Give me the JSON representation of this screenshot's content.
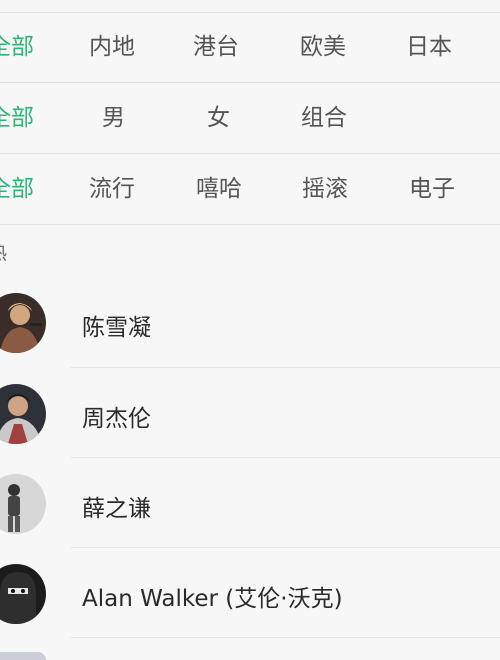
{
  "filters": {
    "region": [
      "全部",
      "内地",
      "港台",
      "欧美",
      "日本"
    ],
    "gender": [
      "全部",
      "男",
      "女",
      "组合"
    ],
    "genre": [
      "全部",
      "流行",
      "嘻哈",
      "摇滚",
      "电子"
    ]
  },
  "hot_section": {
    "label": "热"
  },
  "artists": [
    {
      "name": "陈雪凝",
      "avatar_icon": "person-avatar-icon"
    },
    {
      "name": "周杰伦",
      "avatar_icon": "person-avatar-icon"
    },
    {
      "name": "薛之谦",
      "avatar_icon": "person-avatar-icon"
    },
    {
      "name": "Alan Walker (艾伦·沃克)",
      "avatar_icon": "person-avatar-icon"
    }
  ],
  "colors": {
    "accent": "#2bb673",
    "background": "#f7f7f7",
    "inactive_text": "#555555"
  }
}
